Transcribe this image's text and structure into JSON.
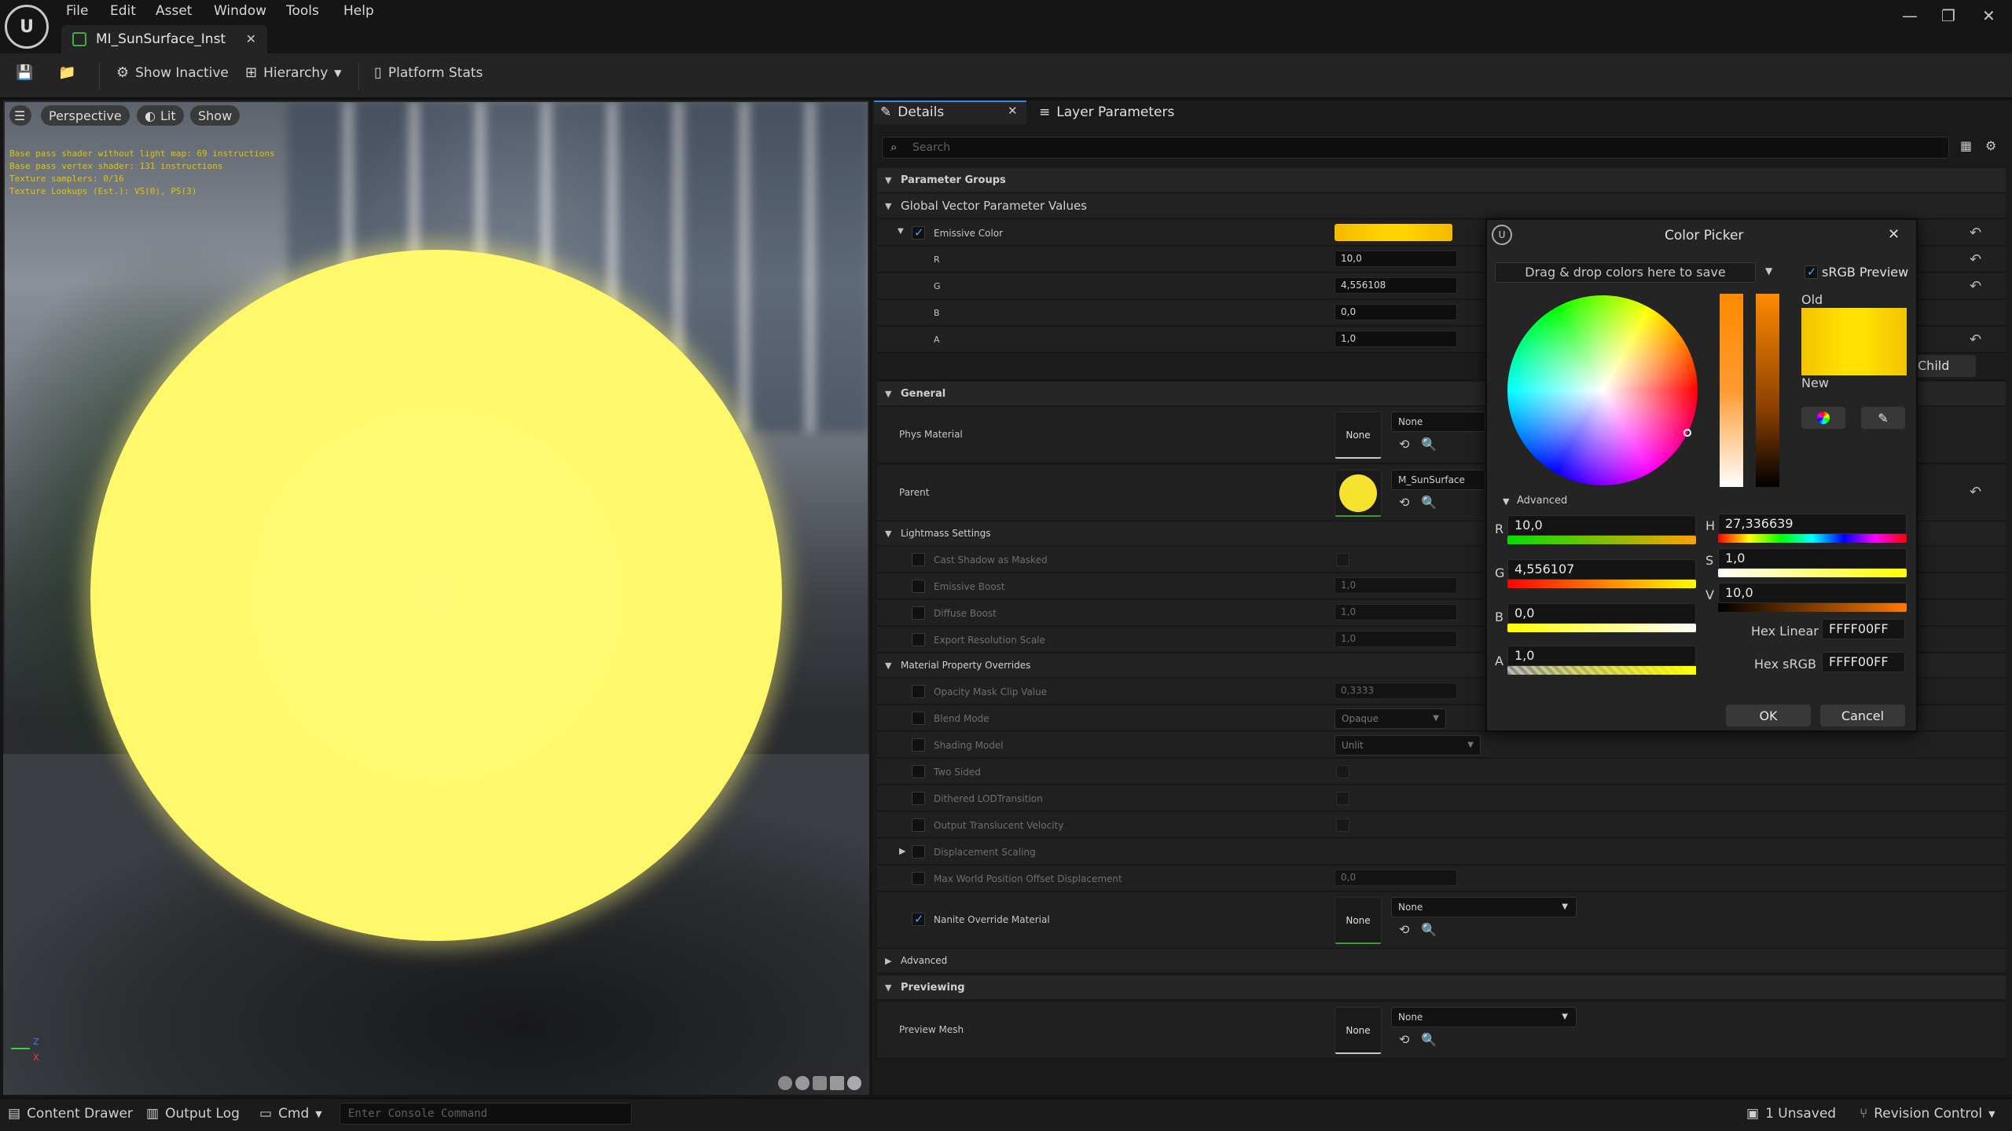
{
  "menu": [
    "File",
    "Edit",
    "Asset",
    "Window",
    "Tools",
    "Help"
  ],
  "tab": {
    "title": "MI_SunSurface_Inst"
  },
  "toolbar": {
    "show_inactive": "Show Inactive",
    "hierarchy": "Hierarchy",
    "platform_stats": "Platform Stats"
  },
  "viewport": {
    "perspective": "Perspective",
    "lit": "Lit",
    "show": "Show",
    "stats": [
      "Base pass shader without light map: 69 instructions",
      "Base pass vertex shader: 131 instructions",
      "Texture samplers: 0/16",
      "Texture Lookups (Est.): VS(0), PS(3)"
    ],
    "axis_z": "Z",
    "axis_x": "X"
  },
  "details": {
    "tab_details": "Details",
    "tab_layers": "Layer Parameters",
    "search_placeholder": "Search",
    "param_groups": "Parameter Groups",
    "global_vector": "Global Vector Parameter Values",
    "emissive": "Emissive Color",
    "emissive_color": "#f7c400",
    "r_label": "R",
    "r": "10,0",
    "g_label": "G",
    "g": "4,556108",
    "b_label": "B",
    "b": "0,0",
    "a_label": "A",
    "a": "1,0",
    "child": "Child",
    "general": "General",
    "phys_material": "Phys Material",
    "none": "None",
    "parent": "Parent",
    "parent_value": "M_SunSurface",
    "lightmass": "Lightmass Settings",
    "cast_shadow": "Cast Shadow as Masked",
    "emissive_boost": "Emissive Boost",
    "emissive_boost_v": "1,0",
    "diffuse_boost": "Diffuse Boost",
    "diffuse_boost_v": "1,0",
    "export_res": "Export Resolution Scale",
    "export_res_v": "1,0",
    "mpo": "Material Property Overrides",
    "opacity_clip": "Opacity Mask Clip Value",
    "opacity_clip_v": "0,3333",
    "blend_mode": "Blend Mode",
    "blend_mode_v": "Opaque",
    "shading_model": "Shading Model",
    "shading_model_v": "Unlit",
    "two_sided": "Two Sided",
    "dithered": "Dithered LODTransition",
    "otv": "Output Translucent Velocity",
    "disp_scaling": "Displacement Scaling",
    "max_wpo": "Max World Position Offset Displacement",
    "max_wpo_v": "0,0",
    "nanite": "Nanite Override Material",
    "advanced": "Advanced",
    "previewing": "Previewing",
    "preview_mesh": "Preview Mesh"
  },
  "picker": {
    "title": "Color Picker",
    "drag_drop": "Drag & drop colors here to save",
    "srgb": "sRGB Preview",
    "old": "Old",
    "new": "New",
    "advanced": "Advanced",
    "r_label": "R",
    "r": "10,0",
    "g_label": "G",
    "g": "4,556107",
    "b_label": "B",
    "b": "0,0",
    "a_label": "A",
    "a": "1,0",
    "h_label": "H",
    "h": "27,336639",
    "s_label": "S",
    "s": "1,0",
    "v_label": "V",
    "v": "10,0",
    "hex_linear_label": "Hex Linear",
    "hex_linear": "FFFF00FF",
    "hex_srgb_label": "Hex sRGB",
    "hex_srgb": "FFFF00FF",
    "ok": "OK",
    "cancel": "Cancel"
  },
  "status": {
    "content_drawer": "Content Drawer",
    "output_log": "Output Log",
    "cmd": "Cmd",
    "console_placeholder": "Enter Console Command",
    "unsaved": "1 Unsaved",
    "revision": "Revision Control"
  }
}
